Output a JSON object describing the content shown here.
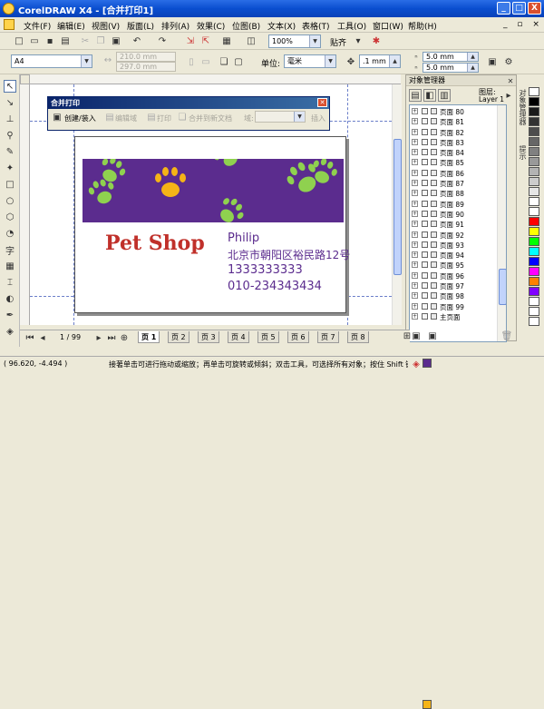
{
  "title": "CorelDRAW X4 - [合并打印1]",
  "window_buttons": {
    "minimize": "_",
    "maximize": "□",
    "close": "X"
  },
  "menu": [
    "文件(F)",
    "编辑(E)",
    "视图(V)",
    "版面(L)",
    "排列(A)",
    "效果(C)",
    "位图(B)",
    "文本(X)",
    "表格(T)",
    "工具(O)",
    "窗口(W)",
    "帮助(H)"
  ],
  "menu_right": "_ ▫ ×",
  "toolbar": {
    "zoom": "100%",
    "snap": "贴齐"
  },
  "property_bar": {
    "page_size": "A4",
    "width": "210.0 mm",
    "height": "297.0 mm",
    "units_label": "单位:",
    "units": "毫米",
    "nudge": ".1 mm",
    "dup_x": "5.0 mm",
    "dup_y": "5.0 mm"
  },
  "merge_window": {
    "title": "合并打印",
    "create_load": "创建/装入",
    "edit_field": "编辑域",
    "print": "打印",
    "merge_to_doc": "合并到新文档",
    "field_label": "域:",
    "insert": "插入"
  },
  "card": {
    "shop_name": "Pet Shop",
    "person_name": "Philip",
    "address": "北京市朝阳区裕民路12号",
    "phone1": "1333333333",
    "phone2": "010-234343434",
    "colors": {
      "banner": "#5b2c8e",
      "paw_green": "#8fd14f",
      "paw_yellow": "#f5b417",
      "shop_red": "#c0302a",
      "text_purple": "#5b2c8e"
    }
  },
  "object_manager": {
    "title": "对象管理器",
    "layer_header_label": "图层:",
    "layer_header_value": "Layer 1",
    "pages": [
      "页面 80",
      "页面 81",
      "页面 82",
      "页面 83",
      "页面 84",
      "页面 85",
      "页面 86",
      "页面 87",
      "页面 88",
      "页面 89",
      "页面 90",
      "页面 91",
      "页面 92",
      "页面 93",
      "页面 94",
      "页面 95",
      "页面 96",
      "页面 97",
      "页面 98",
      "页面 99",
      "主页面"
    ]
  },
  "docker_tabs": [
    "对象管理器",
    "对象属性",
    "提示"
  ],
  "page_nav": {
    "counter": "1 / 99",
    "tabs": [
      "页 1",
      "页 2",
      "页 3",
      "页 4",
      "页 5",
      "页 6",
      "页 7",
      "页 8"
    ]
  },
  "status": {
    "coords": "( 96.620, -4.494 )",
    "hint": "接著单击可进行拖动或缩放；再单击可旋转或倾斜；双击工具，可选择所有对象；按住 Shift 键单击可..."
  },
  "palette_colors": [
    "#ffffff",
    "#000000",
    "#1a1a1a",
    "#333333",
    "#4d4d4d",
    "#666666",
    "#808080",
    "#999999",
    "#b3b3b3",
    "#cccccc",
    "#e6e6e6",
    "#ffffff",
    "#ffffff",
    "#ff0000",
    "#ffff00",
    "#00ff00",
    "#00ffff",
    "#0000ff",
    "#ff00ff",
    "#ff8000",
    "#8000ff",
    "#ffffff",
    "#ffffff",
    "#ffffff"
  ]
}
